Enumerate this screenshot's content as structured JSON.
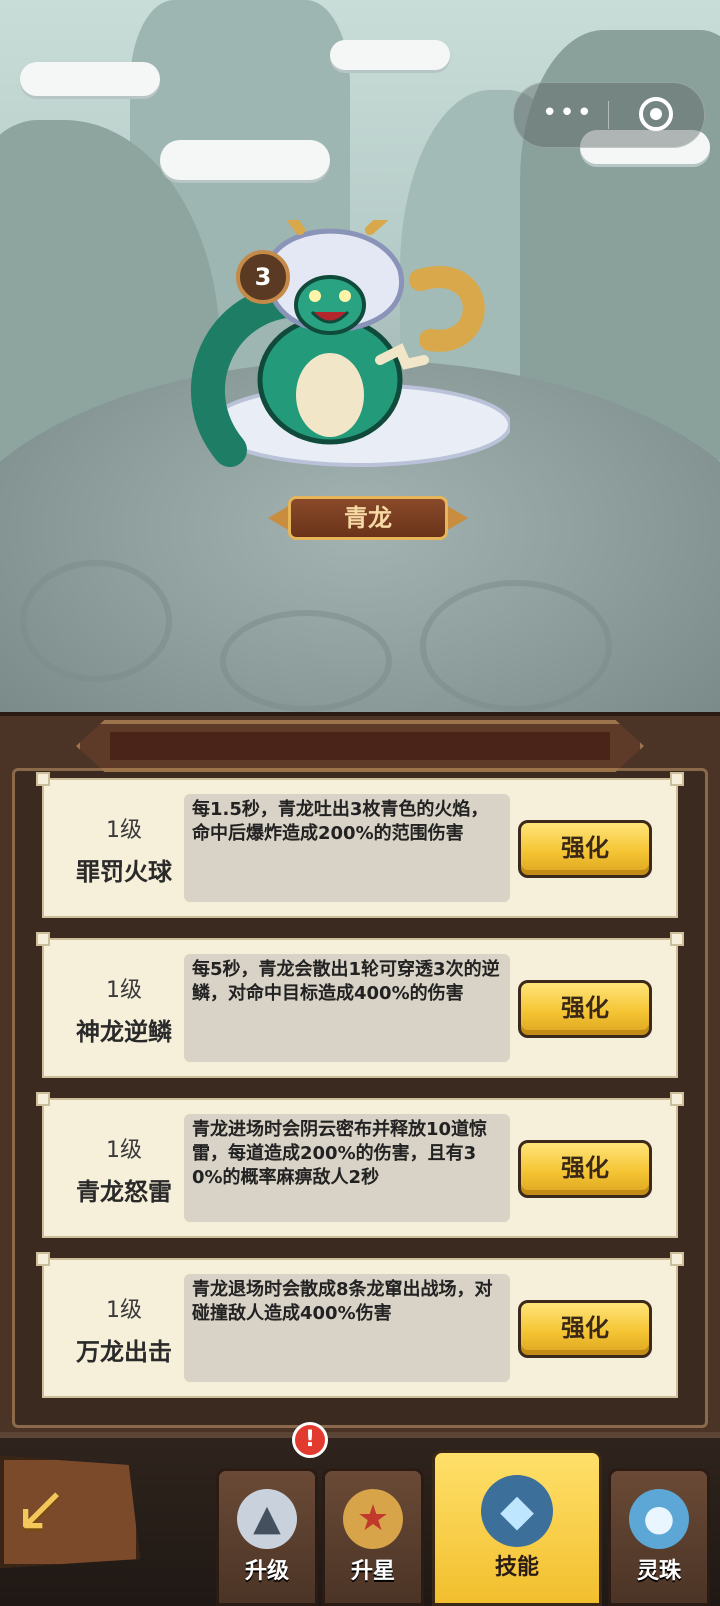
{
  "hero": {
    "level": "3",
    "name": "青龙"
  },
  "menu": {
    "more_icon": "more-dots-icon",
    "close_icon": "target-close-icon"
  },
  "skills": [
    {
      "level": "1级",
      "name": "罪罚火球",
      "desc": "每1.5秒，青龙吐出3枚青色的火焰，命中后爆炸造成200%的范围伤害",
      "button": "强化"
    },
    {
      "level": "1级",
      "name": "神龙逆鳞",
      "desc": "每5秒，青龙会散出1轮可穿透3次的逆鳞，对命中目标造成400%的伤害",
      "button": "强化"
    },
    {
      "level": "1级",
      "name": "青龙怒雷",
      "desc": "青龙进场时会阴云密布并释放10道惊雷，每道造成200%的伤害，且有30%的概率麻痹敌人2秒",
      "button": "强化"
    },
    {
      "level": "1级",
      "name": "万龙出击",
      "desc": "青龙退场时会散成8条龙窜出战场，对碰撞敌人造成400%伤害",
      "button": "强化"
    }
  ],
  "tabs": [
    {
      "label": "升级",
      "icon": "dragon-head-upgrade-icon"
    },
    {
      "label": "升星",
      "icon": "star-emblem-icon"
    },
    {
      "label": "技能",
      "icon": "skill-stone-icon",
      "active": true
    },
    {
      "label": "灵珠",
      "icon": "spirit-orb-icon"
    }
  ],
  "alert": "!",
  "colors": {
    "button_yellow": "#f5c534",
    "panel_brown": "#4b3426",
    "card_bg": "#f6efd9"
  }
}
